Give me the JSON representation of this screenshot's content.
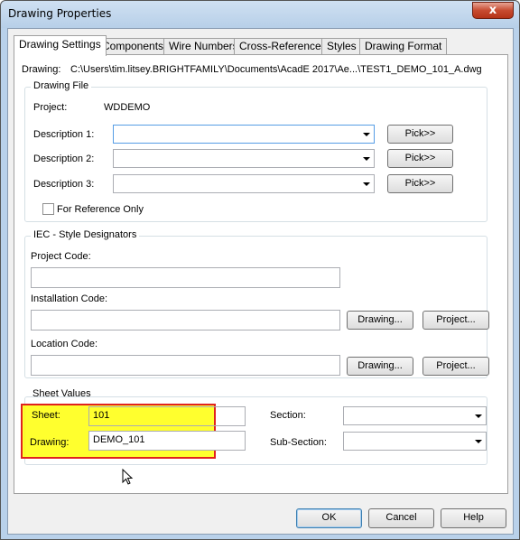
{
  "window": {
    "title": "Drawing Properties",
    "close_label": "x"
  },
  "tabs": [
    {
      "label": "Drawing Settings",
      "active": true
    },
    {
      "label": "Components"
    },
    {
      "label": "Wire Numbers"
    },
    {
      "label": "Cross-References"
    },
    {
      "label": "Styles"
    },
    {
      "label": "Drawing Format"
    }
  ],
  "drawing_path": {
    "label": "Drawing:",
    "value": "C:\\Users\\tim.litsey.BRIGHTFAMILY\\Documents\\AcadE 2017\\Ae...\\TEST1_DEMO_101_A.dwg"
  },
  "drawing_file": {
    "group_title": "Drawing File",
    "project_label": "Project:",
    "project_value": "WDDEMO",
    "descriptions": [
      {
        "label": "Description 1:",
        "value": "",
        "pick_label": "Pick>>"
      },
      {
        "label": "Description 2:",
        "value": "",
        "pick_label": "Pick>>"
      },
      {
        "label": "Description 3:",
        "value": "",
        "pick_label": "Pick>>"
      }
    ],
    "reference_only_label": "For Reference Only",
    "reference_only_checked": false
  },
  "iec": {
    "group_title": "IEC - Style Designators",
    "project_code_label": "Project Code:",
    "project_code_value": "",
    "installation_code_label": "Installation Code:",
    "installation_code_value": "",
    "location_code_label": "Location Code:",
    "location_code_value": "",
    "drawing_btn": "Drawing...",
    "project_btn": "Project..."
  },
  "sheet_values": {
    "group_title": "Sheet Values",
    "sheet_label": "Sheet:",
    "sheet_value": "101",
    "drawing_label": "Drawing:",
    "drawing_value": "DEMO_101",
    "section_label": "Section:",
    "section_value": "",
    "subsection_label": "Sub-Section:",
    "subsection_value": ""
  },
  "footer": {
    "ok_label": "OK",
    "cancel_label": "Cancel",
    "help_label": "Help"
  },
  "colors": {
    "highlight_fill": "#ffff00",
    "highlight_border": "#e0221d",
    "window_frame": "#b9d1ea"
  }
}
